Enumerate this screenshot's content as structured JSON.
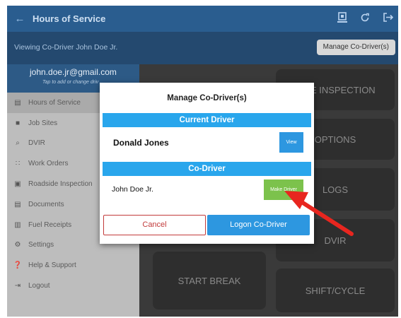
{
  "appbar": {
    "title": "Hours of Service",
    "back_icon": "←",
    "icons": [
      "transfer-icon",
      "refresh-icon",
      "logout-icon"
    ]
  },
  "subbar": {
    "viewing": "Viewing Co-Driver John Doe Jr.",
    "manage_button": "Manage Co-Driver(s)"
  },
  "drawer": {
    "email": "john.doe.jr@gmail.com",
    "hint": "Tap to add or change driv",
    "items": [
      {
        "label": "Hours of Service",
        "icon": "▤"
      },
      {
        "label": "Job Sites",
        "icon": "■"
      },
      {
        "label": "DVIR",
        "icon": "⌕"
      },
      {
        "label": "Work Orders",
        "icon": "∷"
      },
      {
        "label": "Roadside Inspection",
        "icon": "▣"
      },
      {
        "label": "Documents",
        "icon": "▤"
      },
      {
        "label": "Fuel Receipts",
        "icon": "▥"
      },
      {
        "label": "Settings",
        "icon": "⚙"
      },
      {
        "label": "Help & Support",
        "icon": "❓"
      },
      {
        "label": "Logout",
        "icon": "⇥"
      }
    ]
  },
  "tiles": {
    "inspection": "SIDE INSPECTION",
    "options": "OPTIONS",
    "logs": "LOGS",
    "dvir": "DVIR",
    "start_break": "START BREAK",
    "shift_cycle": "SHIFT/CYCLE"
  },
  "dialog": {
    "title": "Manage Co-Driver(s)",
    "current_driver_header": "Current Driver",
    "current_driver_name": "Donald Jones",
    "view_button": "View",
    "co_driver_header": "Co-Driver",
    "co_driver_name": "John Doe Jr.",
    "make_driver_button": "Make Driver",
    "cancel_button": "Cancel",
    "logon_button": "Logon Co-Driver"
  },
  "colors": {
    "appbar": "#2a5d8f",
    "section_header": "#29a6ec",
    "make_driver": "#7cc24c",
    "arrow": "#e8261f"
  }
}
